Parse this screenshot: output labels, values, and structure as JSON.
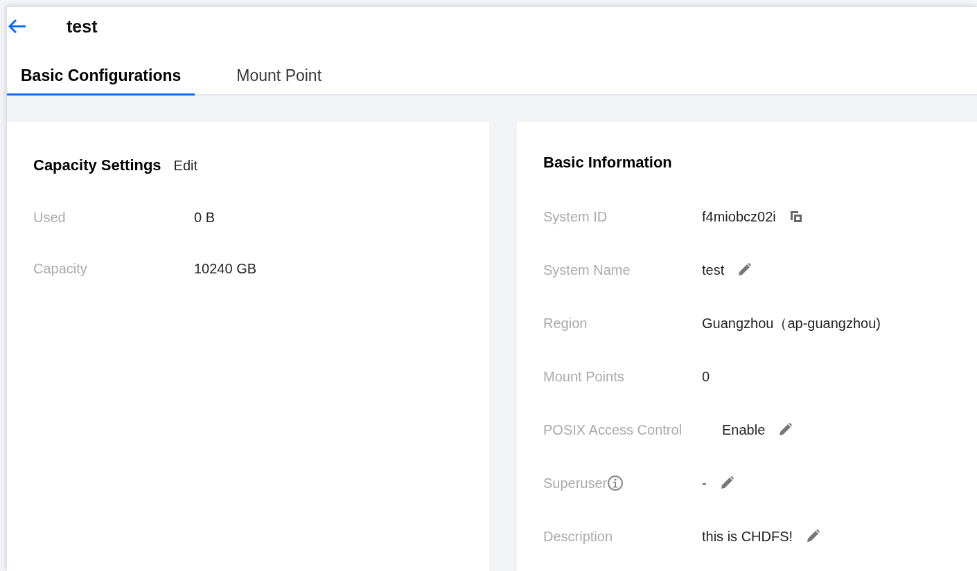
{
  "header": {
    "title": "test"
  },
  "tabs": [
    {
      "label": "Basic Configurations",
      "selected": true
    },
    {
      "label": "Mount Point",
      "selected": false
    }
  ],
  "capacity": {
    "title": "Capacity Settings",
    "action": "Edit",
    "rows": [
      {
        "label": "Used",
        "value": "0 B"
      },
      {
        "label": "Capacity",
        "value": "10240 GB"
      }
    ]
  },
  "basic_info": {
    "title": "Basic Information",
    "rows": [
      {
        "label": "System ID",
        "value": "f4miobcz02i",
        "help": false,
        "kind": "copy"
      },
      {
        "label": "System Name",
        "value": "test",
        "help": false,
        "kind": "edit"
      },
      {
        "label": "Region",
        "value": "Guangzhou（ap-guangzhou)",
        "help": false,
        "kind": "plain"
      },
      {
        "label": "Mount Points",
        "value": "0",
        "help": false,
        "kind": "plain"
      },
      {
        "label": "POSIX Access Control",
        "value": "Enable",
        "help": false,
        "kind": "edit"
      },
      {
        "label": "Superuser",
        "value": "-",
        "help": true,
        "kind": "edit"
      },
      {
        "label": "Description",
        "value": "this is CHDFS!",
        "help": false,
        "kind": "edit"
      }
    ]
  }
}
